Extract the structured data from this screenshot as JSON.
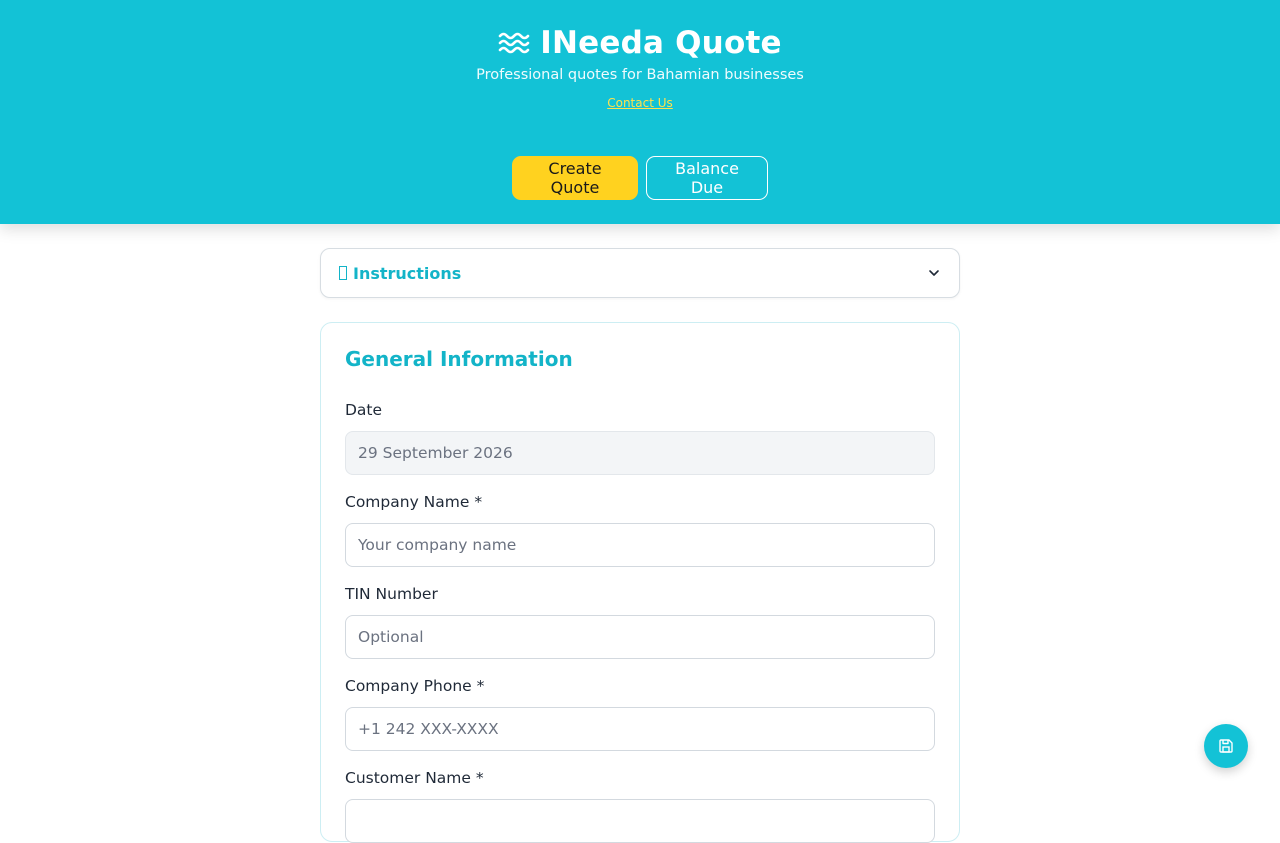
{
  "header": {
    "title": "INeeda Quote",
    "tagline": "Professional quotes for Bahamian businesses",
    "contact_link": "Contact Us",
    "brand_icon": "waves-icon",
    "colors": {
      "background": "#13c2d6",
      "accent": "#ffd21f",
      "link": "#ffe14d"
    }
  },
  "nav": {
    "create_quote": "Create Quote",
    "balance_due": "Balance Due"
  },
  "instructions": {
    "icon": "info-icon",
    "label": "Instructions",
    "toggle_icon": "chevron-down-icon",
    "expanded": false
  },
  "general": {
    "title": "General Information",
    "fields": {
      "date": {
        "label": "Date",
        "value": "29 September 2026",
        "placeholder": ""
      },
      "company_name": {
        "label": "Company Name *",
        "value": "",
        "placeholder": "Your company name"
      },
      "tin": {
        "label": "TIN Number",
        "value": "",
        "placeholder": "Optional"
      },
      "company_phone": {
        "label": "Company Phone *",
        "value": "",
        "placeholder": "+1 242 XXX-XXXX"
      },
      "customer_name": {
        "label": "Customer Name *"
      }
    }
  },
  "fab": {
    "icon": "save-icon"
  }
}
